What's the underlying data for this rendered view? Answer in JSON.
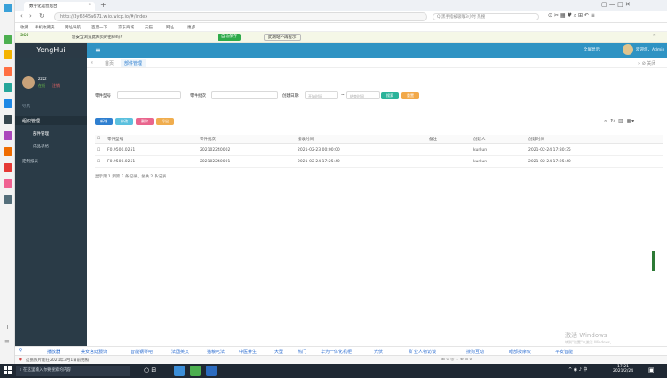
{
  "browser": {
    "tab_label": "数字化运营后台",
    "new_tab_label": "+",
    "url": "http://3y6845a671.w.io.wicp.io/#/index",
    "search_placeholder": "Q 黑手指被吸喉3小时 热搜",
    "bookmarks": [
      "收藏",
      "手机收藏夹",
      "网址导航",
      "百度一下",
      "京东商城",
      "天猫",
      "网址",
      "更多"
    ],
    "notice": "您安全浏览此网页的密码吗?",
    "notice_actions": [
      "自动保存",
      "此网站不再提示"
    ]
  },
  "app": {
    "logo": "YongHui",
    "menu_icon": "hamburger-icon",
    "header_right": [
      "全屏显示",
      "欢迎您，Admin"
    ],
    "user": {
      "name": "zzzz",
      "status": "在线",
      "sub": "注销"
    },
    "sidebar": {
      "section": "导航",
      "group_label": "组织管理",
      "items": [
        "部件管理",
        "成品表格"
      ],
      "group2_label": "定制报表"
    },
    "breadcrumbs": [
      "首页",
      "部件管理"
    ],
    "filters": {
      "field1_label": "零件型号",
      "field2_label": "零件批次",
      "date_label": "创建日期:",
      "date_from_placeholder": "开始时间",
      "date_sep": "~",
      "date_to_placeholder": "结束时间",
      "search_button": "搜索",
      "reset_button": "重置"
    },
    "toolbar": [
      "新增",
      "修改",
      "删除",
      "导出"
    ],
    "table": {
      "columns": [
        "零件型号",
        "零件批次",
        "接收时间",
        "备注",
        "创建人",
        "创建时间"
      ],
      "rows": [
        [
          "F0.9500.0251",
          "202102240002",
          "2021-02-23 00:00:00",
          "",
          "kunlun",
          "2021-02-24 17:30:35"
        ],
        [
          "F0.9500.0251",
          "202102240001",
          "2021-02-24 17:25:40",
          "",
          "kunlun",
          "2021-02-24 17:25:40"
        ]
      ],
      "footer": "显示第 1 到第 2 条记录，总共 2 条记录"
    }
  },
  "bottom_links": [
    "播放器",
    "美女宫廷服饰",
    "智能钢琴吧",
    "法国英文",
    "猫粮吃法",
    "中医养生",
    "大型",
    "热门",
    "华为一体化机柜",
    "光伏",
    "矿业人物访谈",
    "搜狗互动",
    "眼部按摩仪",
    "平安智能"
  ],
  "status_bar": "这张照片能在2021年3月1日前拍照",
  "taskbar": {
    "search_placeholder": "在这里输入你要搜索的内容",
    "time": "17:21",
    "date": "2021/2/24"
  },
  "watermark": [
    "激活 Windows",
    "转到\"设置\"以激活 Windows。"
  ],
  "colors": {
    "header": "#2f93c3",
    "sidebar": "#2a3b47",
    "btn_add": "#2f7fd0",
    "btn_edit": "#5bc0de",
    "btn_delete": "#e9658d",
    "btn_export": "#f0ad4e",
    "btn_search": "#2bb39a",
    "btn_reset": "#f2a94a"
  }
}
